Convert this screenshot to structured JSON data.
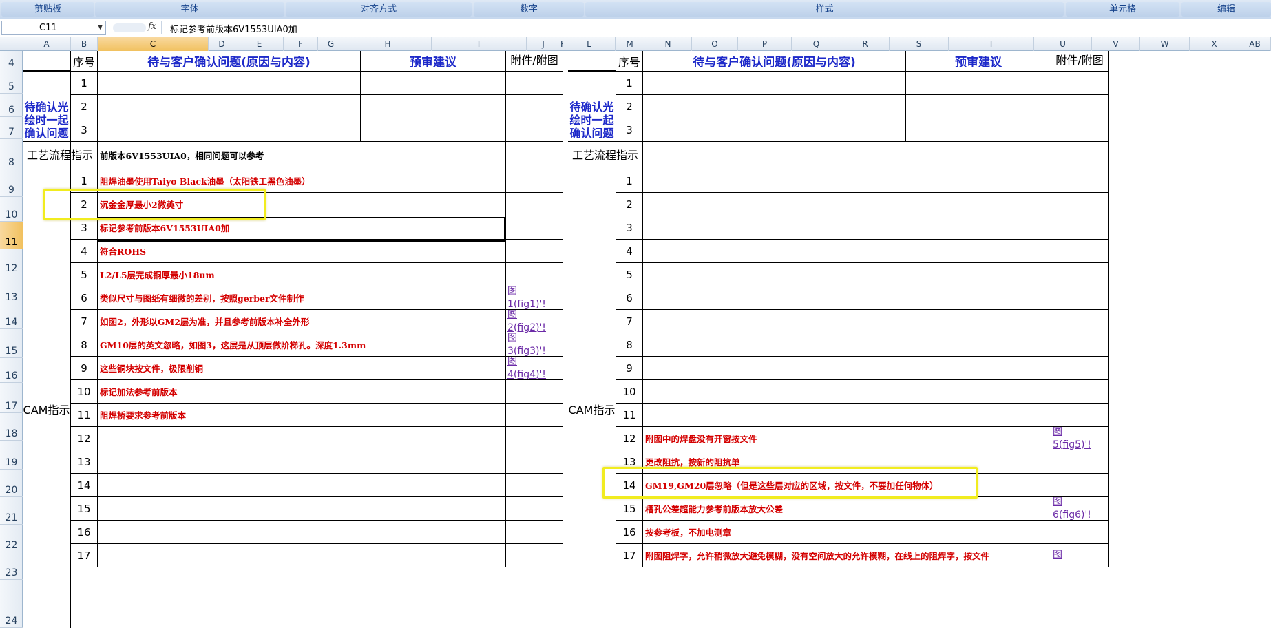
{
  "ribbon": {
    "groups": [
      "剪贴板",
      "字体",
      "对齐方式",
      "数字",
      "样式",
      "单元格",
      "编辑"
    ]
  },
  "formula_bar": {
    "name_box": "C11",
    "fx_label": "fx",
    "content": "标记参考前版本6V1553UIA0加"
  },
  "columns": [
    "A",
    "B",
    "C",
    "D",
    "E",
    "F",
    "G",
    "H",
    "I",
    "J",
    "K",
    "L",
    "M",
    "N",
    "O",
    "P",
    "Q",
    "R",
    "S",
    "T",
    "U",
    "V",
    "W",
    "X",
    "AB"
  ],
  "rows": [
    "4",
    "5",
    "6",
    "7",
    "8",
    "9",
    "10",
    "11",
    "12",
    "13",
    "14",
    "15",
    "16",
    "17",
    "18",
    "19",
    "20",
    "21",
    "22",
    "23",
    "24"
  ],
  "selected_cell": {
    "column": "C",
    "row": "11"
  },
  "left_sheet": {
    "headers": {
      "seq": "序号",
      "question": "待与客户确认问题(原因与内容)",
      "suggestion": "预审建议",
      "attachment": "附件/附图"
    },
    "confirm_label": "待确认光绘时一起确认问题",
    "confirm_rows": [
      "1",
      "2",
      "3"
    ],
    "process_label": "工艺流程指示",
    "process_text": "前版本6V1553UIA0，相同问题可以参考",
    "cam_label": "CAM指示",
    "cam_rows": [
      {
        "n": "1",
        "text": "阻焊油墨使用Taiyo Black油墨（太阳铁工黑色油墨）",
        "link": [
          "",
          ""
        ]
      },
      {
        "n": "2",
        "text": "沉金金厚最小2微英寸",
        "link": [
          "",
          ""
        ]
      },
      {
        "n": "3",
        "text": "标记参考前版本6V1553UIA0加",
        "link": [
          "",
          ""
        ]
      },
      {
        "n": "4",
        "text": "符合ROHS",
        "link": [
          "",
          ""
        ]
      },
      {
        "n": "5",
        "text": "L2/L5层完成铜厚最小18um",
        "link": [
          "",
          ""
        ]
      },
      {
        "n": "6",
        "text": "类似尺寸与图纸有细微的差别，按照gerber文件制作",
        "link": [
          "图",
          "1(fig1)'!"
        ]
      },
      {
        "n": "7",
        "text": "如图2，外形以GM2层为准，并且参考前版本补全外形",
        "link": [
          "图",
          "2(fig2)'!"
        ]
      },
      {
        "n": "8",
        "text": "GM10层的英文忽略，如图3，这层是从顶层做阶梯孔。深度1.3mm",
        "link": [
          "图",
          "3(fig3)'!"
        ]
      },
      {
        "n": "9",
        "text": "这些铜块按文件，极限削铜",
        "link": [
          "图",
          "4(fig4)'!"
        ]
      },
      {
        "n": "10",
        "text": "标记加法参考前版本",
        "link": [
          "",
          ""
        ]
      },
      {
        "n": "11",
        "text": "阻焊桥要求参考前版本",
        "link": [
          "",
          ""
        ]
      },
      {
        "n": "12",
        "text": "",
        "link": [
          "",
          ""
        ]
      },
      {
        "n": "13",
        "text": "",
        "link": [
          "",
          ""
        ]
      },
      {
        "n": "14",
        "text": "",
        "link": [
          "",
          ""
        ]
      },
      {
        "n": "15",
        "text": "",
        "link": [
          "",
          ""
        ]
      },
      {
        "n": "16",
        "text": "",
        "link": [
          "",
          ""
        ]
      },
      {
        "n": "17",
        "text": "",
        "link": [
          "",
          ""
        ]
      }
    ]
  },
  "right_sheet": {
    "headers": {
      "seq": "序号",
      "question": "待与客户确认问题(原因与内容)",
      "suggestion": "预审建议",
      "attachment": "附件/附图"
    },
    "confirm_label": "待确认光绘时一起确认问题",
    "confirm_rows": [
      "1",
      "2",
      "3"
    ],
    "process_label": "工艺流程指示",
    "process_text": "",
    "cam_label": "CAM指示",
    "cam_rows": [
      {
        "n": "1",
        "text": "",
        "link": [
          "",
          ""
        ]
      },
      {
        "n": "2",
        "text": "",
        "link": [
          "",
          ""
        ]
      },
      {
        "n": "3",
        "text": "",
        "link": [
          "",
          ""
        ]
      },
      {
        "n": "4",
        "text": "",
        "link": [
          "",
          ""
        ]
      },
      {
        "n": "5",
        "text": "",
        "link": [
          "",
          ""
        ]
      },
      {
        "n": "6",
        "text": "",
        "link": [
          "",
          ""
        ]
      },
      {
        "n": "7",
        "text": "",
        "link": [
          "",
          ""
        ]
      },
      {
        "n": "8",
        "text": "",
        "link": [
          "",
          ""
        ]
      },
      {
        "n": "9",
        "text": "",
        "link": [
          "",
          ""
        ]
      },
      {
        "n": "10",
        "text": "",
        "link": [
          "",
          ""
        ]
      },
      {
        "n": "11",
        "text": "",
        "link": [
          "",
          ""
        ]
      },
      {
        "n": "12",
        "text": "附图中的焊盘没有开窗按文件",
        "link": [
          "图",
          "5(fig5)'!"
        ]
      },
      {
        "n": "13",
        "text": "更改阻抗，按新的阻抗单",
        "link": [
          "",
          ""
        ]
      },
      {
        "n": "14",
        "text": "GM19,GM20层忽略（但是这些层对应的区域，按文件，不要加任何物体）",
        "link": [
          "",
          ""
        ]
      },
      {
        "n": "15",
        "text": "槽孔公差超能力参考前版本放大公差",
        "link": [
          "图",
          "6(fig6)'!"
        ]
      },
      {
        "n": "16",
        "text": "按参考板，不加电测章",
        "link": [
          "",
          ""
        ]
      },
      {
        "n": "17",
        "text": "附图阻焊字，允许稍微放大避免模糊，没有空间放大的允许模糊，在线上的阻焊字，按文件",
        "link": [
          "图",
          ""
        ]
      }
    ]
  },
  "colors": {
    "ribbon": "#c7d8ee",
    "header_blue": "#1d29c9",
    "instruction_red": "#d40000",
    "link_purple": "#6b2aa7",
    "highlight_yellow": "#f1ec1f",
    "selected_header": "#f1c15f"
  }
}
